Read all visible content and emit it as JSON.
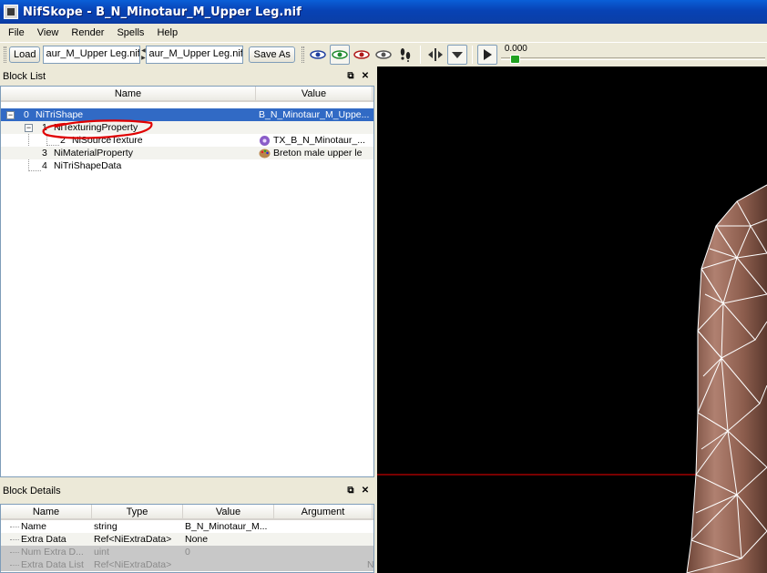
{
  "window": {
    "title": "NifSkope - B_N_Minotaur_M_Upper Leg.nif"
  },
  "menu": [
    "File",
    "View",
    "Render",
    "Spells",
    "Help"
  ],
  "toolbar": {
    "load_label": "Load",
    "load_path": "aur_M_Upper Leg.nif",
    "save_path": "aur_M_Upper Leg.nif",
    "save_as_label": "Save As",
    "time_value": "0.000",
    "time_fraction": 0.0,
    "icons": [
      "view-blue-eye-icon",
      "view-green-eye-icon",
      "view-red-eye-icon",
      "view-grey-eye-icon",
      "footprints-icon",
      "move-icon",
      "dropdown-icon",
      "play-icon"
    ]
  },
  "block_list": {
    "title": "Block List",
    "columns": [
      "Name",
      "Value"
    ],
    "rows": [
      {
        "index": "0",
        "name": "NiTriShape",
        "value": "B_N_Minotaur_M_Uppe..."
      },
      {
        "index": "1",
        "name": "NiTexturingProperty",
        "value": ""
      },
      {
        "index": "2",
        "name": "NiSourceTexture",
        "value": "TX_B_N_Minotaur_..."
      },
      {
        "index": "3",
        "name": "NiMaterialProperty",
        "value": "Breton male upper le"
      },
      {
        "index": "4",
        "name": "NiTriShapeData",
        "value": ""
      }
    ],
    "highlight_color": "#e00000"
  },
  "block_details": {
    "title": "Block Details",
    "columns": [
      "Name",
      "Type",
      "Value",
      "Argument"
    ],
    "rows": [
      {
        "name": "Name",
        "type": "string",
        "value": "B_N_Minotaur_M...",
        "argument": ""
      },
      {
        "name": "Extra Data",
        "type": "Ref<NiExtraData>",
        "value": "None",
        "argument": ""
      },
      {
        "name": "Num Extra D...",
        "type": "uint",
        "value": "0",
        "argument": ""
      },
      {
        "name": "Extra Data List",
        "type": "Ref<NiExtraData>",
        "value": "",
        "argument": "N"
      }
    ]
  },
  "colors": {
    "selection": "#316ac5",
    "title_bar": "#0a46b8",
    "viewport_bg": "#000000",
    "axis_line": "#c00000",
    "mesh_skin": "#9a6a58",
    "wireframe": "#ffffff"
  }
}
